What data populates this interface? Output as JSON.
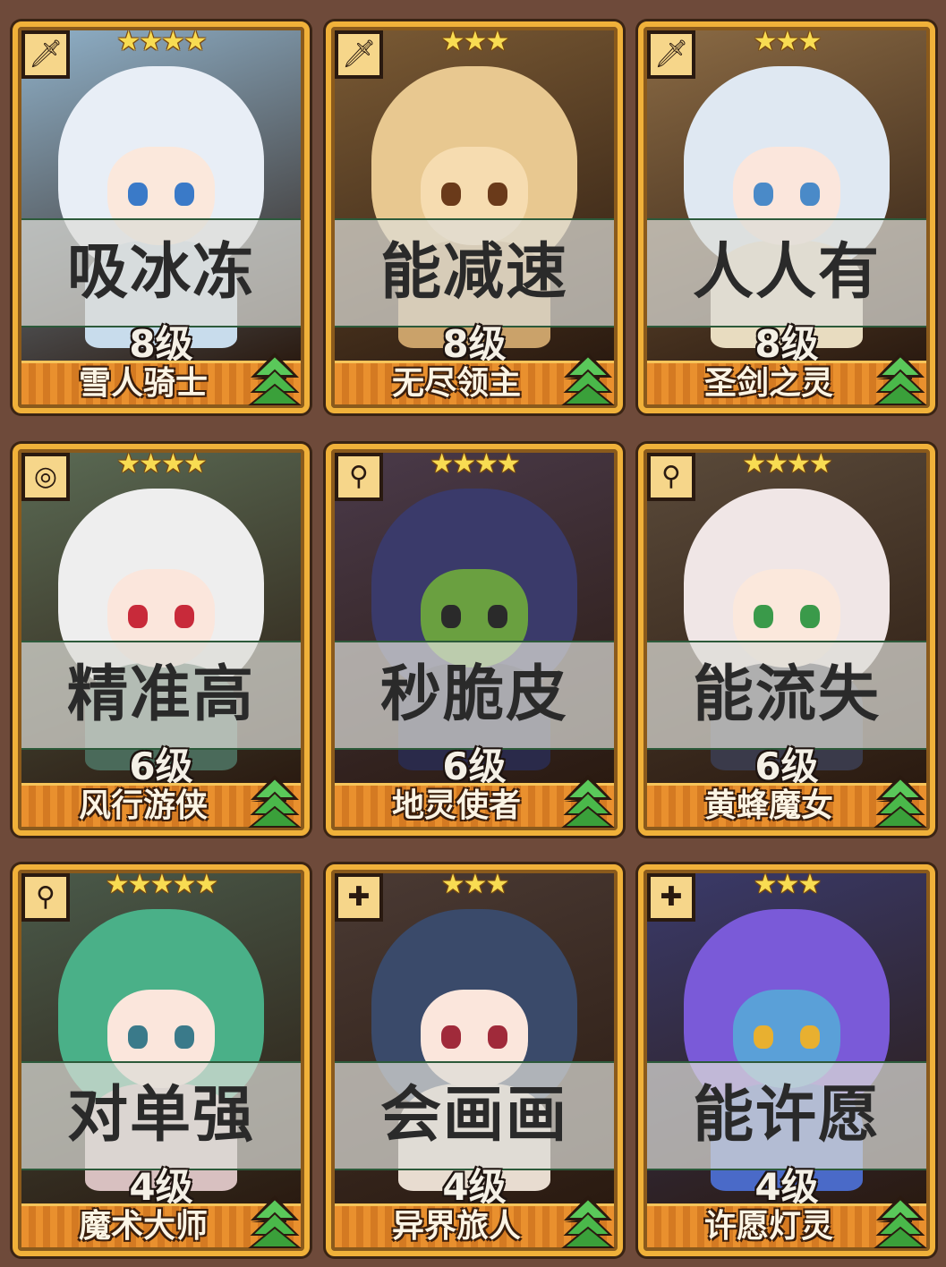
{
  "cards": [
    {
      "skill": "吸冰冻",
      "level": "8级",
      "name": "雪人骑士",
      "stars": "★★★★",
      "icon": "sword-icon",
      "colors": {
        "bg": "#8fb0c8",
        "hair": "#e8eef6",
        "face": "#fbe8dc",
        "eye": "#3a7ac8",
        "body": "#c8dcec",
        "accent": "#4ab0e8"
      }
    },
    {
      "skill": "能减速",
      "level": "8级",
      "name": "无尽领主",
      "stars": "★★★",
      "icon": "sword-icon",
      "colors": {
        "bg": "#7a5a34",
        "hair": "#e8c890",
        "face": "#f6dcb0",
        "eye": "#6a3a1a",
        "body": "#caa26a",
        "accent": "#d48a3a"
      }
    },
    {
      "skill": "人人有",
      "level": "8级",
      "name": "圣剑之灵",
      "stars": "★★★",
      "icon": "sword-icon",
      "colors": {
        "bg": "#8a6a44",
        "hair": "#dfe8f2",
        "face": "#fbe6dc",
        "eye": "#4a8ac8",
        "body": "#e8dcc0",
        "accent": "#c89a3a"
      }
    },
    {
      "skill": "精准高",
      "level": "6级",
      "name": "风行游侠",
      "stars": "★★★★",
      "icon": "target-icon",
      "colors": {
        "bg": "#5a6a54",
        "hair": "#eeeeee",
        "face": "#fbe6dc",
        "eye": "#c82a3a",
        "body": "#4a6a5a",
        "accent": "#c87a3a"
      }
    },
    {
      "skill": "秒脆皮",
      "level": "6级",
      "name": "地灵使者",
      "stars": "★★★★",
      "icon": "staff-icon",
      "colors": {
        "bg": "#4a3a4a",
        "hair": "#3a3a6a",
        "face": "#6aa040",
        "eye": "#2a2a2a",
        "body": "#2a2a4a",
        "accent": "#c8c0d8"
      }
    },
    {
      "skill": "能流失",
      "level": "6级",
      "name": "黄蜂魔女",
      "stars": "★★★★",
      "icon": "staff-icon",
      "colors": {
        "bg": "#5a4a3a",
        "hair": "#f0e6e6",
        "face": "#fbe8dc",
        "eye": "#3a9a4a",
        "body": "#3a3a4a",
        "accent": "#2a2a3a"
      }
    },
    {
      "skill": "对单强",
      "level": "4级",
      "name": "魔术大师",
      "stars": "★★★★★",
      "icon": "staff-icon",
      "colors": {
        "bg": "#4a5a4a",
        "hair": "#4ab088",
        "face": "#fbe6dc",
        "eye": "#3a7a8a",
        "body": "#d8c0c0",
        "accent": "#c82a3a"
      }
    },
    {
      "skill": "会画画",
      "level": "4级",
      "name": "异界旅人",
      "stars": "★★★",
      "icon": "holy-cross-icon",
      "colors": {
        "bg": "#4a3a34",
        "hair": "#3a4a6a",
        "face": "#fbe6dc",
        "eye": "#a02a3a",
        "body": "#e8dcd0",
        "accent": "#d8b040"
      }
    },
    {
      "skill": "能许愿",
      "level": "4级",
      "name": "许愿灯灵",
      "stars": "★★★",
      "icon": "holy-cross-icon",
      "colors": {
        "bg": "#3a3a6a",
        "hair": "#7a5ad8",
        "face": "#5aa0d8",
        "eye": "#e8b030",
        "body": "#4a6ac8",
        "accent": "#e84a4a"
      }
    }
  ],
  "upgrade_icon": "upgrade-arrow-icon",
  "accent": {
    "frame": "#f0b13a",
    "plate": "#e9902e",
    "upgrade": "#4ab84a"
  }
}
